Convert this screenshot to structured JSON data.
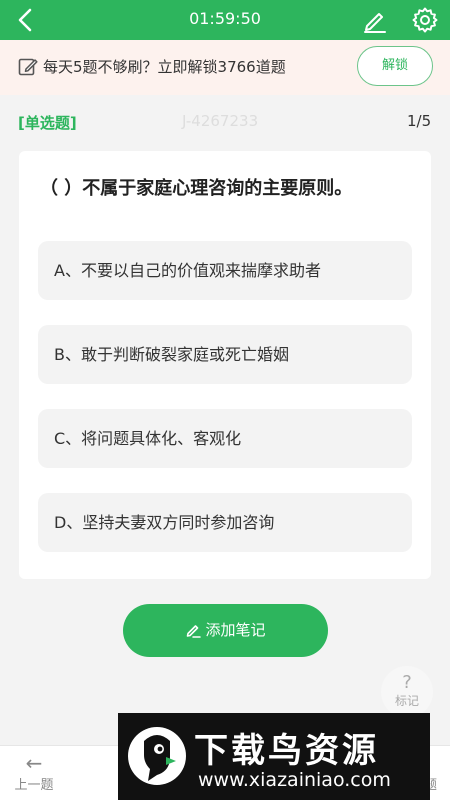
{
  "header": {
    "timer": "01:59:50",
    "back_icon": "chevron-left-icon",
    "edit_icon": "pencil-icon",
    "settings_icon": "gear-icon",
    "bg_color": "#2db55d"
  },
  "promo": {
    "icon": "edit-note-icon",
    "text": "每天5题不够刷？立即解锁3766道题",
    "unlock_label": "解锁",
    "bg_color": "#fdf2ee"
  },
  "meta": {
    "question_type": "[单选题]",
    "question_id": "J-4267233",
    "progress": "1/5"
  },
  "question": {
    "text": "（ ）不属于家庭心理咨询的主要原则。",
    "options": [
      {
        "label": "A、不要以自己的价值观来揣摩求助者"
      },
      {
        "label": "B、敢于判断破裂家庭或死亡婚姻"
      },
      {
        "label": "C、将问题具体化、客观化"
      },
      {
        "label": "D、坚持夫妻双方同时参加咨询"
      }
    ]
  },
  "actions": {
    "add_note_label": "添加笔记",
    "add_note_icon": "pencil-icon",
    "mark_icon": "question-mark-icon",
    "mark_label": "标记",
    "accent_color": "#2db55d"
  },
  "bottombar": {
    "prev_label": "上一题",
    "prev_icon": "arrow-left-icon",
    "next_label_fragment": "题"
  },
  "watermark": {
    "title": "下载鸟资源",
    "url": "www.xiazainiao.com"
  }
}
